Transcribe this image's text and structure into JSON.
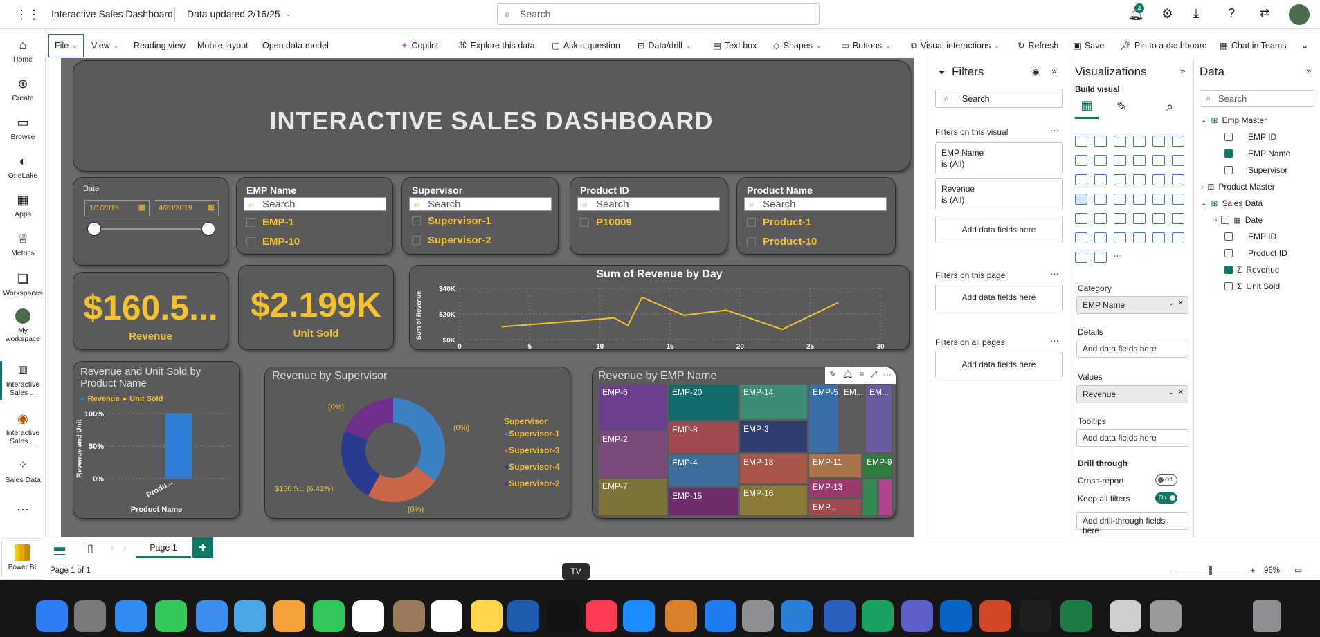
{
  "app": {
    "title": "Interactive Sales Dashboard",
    "updated": "Data updated 2/16/25",
    "search_placeholder": "Search",
    "notif_count": "4"
  },
  "menu": {
    "file": "File",
    "view": "View",
    "reading": "Reading view",
    "mobile": "Mobile layout",
    "open_model": "Open data model",
    "copilot": "Copilot",
    "explore": "Explore this data",
    "ask": "Ask a question",
    "datadrill": "Data/drill",
    "textbox": "Text box",
    "shapes": "Shapes",
    "buttons": "Buttons",
    "visual_interactions": "Visual interactions",
    "refresh": "Refresh",
    "save": "Save",
    "pin": "Pin to a dashboard",
    "chat": "Chat in Teams"
  },
  "nav": [
    {
      "label": "Home"
    },
    {
      "label": "Create"
    },
    {
      "label": "Browse"
    },
    {
      "label": "OneLake"
    },
    {
      "label": "Apps"
    },
    {
      "label": "Metrics"
    },
    {
      "label": "Workspaces"
    },
    {
      "label": "My workspace"
    },
    {
      "label": "Interactive Sales ..."
    },
    {
      "label": "Interactive Sales ..."
    },
    {
      "label": "Sales Data"
    }
  ],
  "dashboard": {
    "title": "INTERACTIVE SALES DASHBOARD",
    "date_slicer": {
      "label": "Date",
      "start": "1/1/2019",
      "end": "4/20/2019"
    },
    "slicers": [
      {
        "header": "EMP Name",
        "search": "Search",
        "items": [
          "EMP-1",
          "EMP-10"
        ]
      },
      {
        "header": "Supervisor",
        "search": "Search",
        "items": [
          "Supervisor-1",
          "Supervisor-2"
        ]
      },
      {
        "header": "Product ID",
        "search": "Search",
        "items": [
          "P10009"
        ]
      },
      {
        "header": "Product Name",
        "search": "Search",
        "items": [
          "Product-1",
          "Product-10"
        ]
      }
    ],
    "kpi_revenue": {
      "value": "$160.5...",
      "label": "Revenue"
    },
    "kpi_units": {
      "value": "$2.199K",
      "label": "Unit Sold"
    },
    "line_chart": {
      "title": "Sum of Revenue by Day",
      "ylabel": "Sum of Revenue"
    },
    "bar_chart": {
      "title": "Revenue and Unit Sold by Product Name",
      "ylabel": "Revenue and Unit",
      "xlabel": "Product Name",
      "legend": [
        "Revenue",
        "Unit Sold"
      ],
      "category": "Produ..."
    },
    "donut": {
      "title": "Revenue by Supervisor",
      "legend_title": "Supervisor",
      "legend": [
        "Supervisor-1",
        "Supervisor-3",
        "Supervisor-4",
        "Supervisor-2"
      ],
      "labels": [
        "(0%)",
        "(0%)",
        "(0%)",
        "$160.5... (6.41%)"
      ]
    },
    "treemap": {
      "title": "Revenue by EMP Name"
    }
  },
  "chart_data": [
    {
      "type": "line",
      "title": "Sum of Revenue by Day",
      "xlabel": "",
      "ylabel": "Sum of Revenue",
      "xlim": [
        0,
        30
      ],
      "ylim": [
        0,
        40000
      ],
      "x_ticks": [
        "0",
        "5",
        "10",
        "15",
        "20",
        "25",
        "30"
      ],
      "y_ticks": [
        "$0K",
        "$20K",
        "$40K"
      ],
      "grid": true,
      "series": [
        {
          "x": [
            3,
            10,
            11,
            12,
            13,
            16,
            19,
            23,
            27
          ],
          "values": [
            10000,
            16000,
            17000,
            11000,
            33000,
            19000,
            23000,
            8000,
            29000
          ]
        }
      ],
      "color": "#f2c230"
    },
    {
      "type": "bar",
      "title": "Revenue and Unit Sold by Product Name",
      "categories": [
        "Produ..."
      ],
      "y_ticks": [
        "0%",
        "50%",
        "100%"
      ],
      "series": [
        {
          "name": "Revenue",
          "values": [
            96
          ]
        },
        {
          "name": "Unit Sold",
          "values": [
            4
          ]
        }
      ],
      "colors": [
        "#2f7ed8",
        "#f2c230"
      ]
    },
    {
      "type": "pie",
      "title": "Revenue by Supervisor",
      "series": [
        {
          "name": "Supervisor-1",
          "value": 35,
          "color": "#3b82c4"
        },
        {
          "name": "Supervisor-3",
          "value": 23,
          "color": "#c8674a"
        },
        {
          "name": "Supervisor-4",
          "value": 23,
          "color": "#2a3b8f"
        },
        {
          "name": "Supervisor-2",
          "value": 19,
          "color": "#6e2f8a"
        }
      ]
    },
    {
      "type": "treemap",
      "title": "Revenue by EMP Name",
      "labels": [
        "EMP-6",
        "EMP-2",
        "EMP-7",
        "EMP-20",
        "EMP-8",
        "EMP-4",
        "EMP-15",
        "EMP-14",
        "EMP-3",
        "EMP-18",
        "EMP-16",
        "EMP-5",
        "EM...",
        "EM...",
        "EMP-11",
        "EMP-9",
        "EMP-13",
        "EMP..."
      ]
    }
  ],
  "filters": {
    "title": "Filters",
    "search": "Search",
    "on_visual": "Filters on this visual",
    "emp_name": "EMP Name",
    "is_all": "is (All)",
    "revenue": "Revenue",
    "is_all2": "is (All)",
    "add": "Add data fields here",
    "on_page": "Filters on this page",
    "add2": "Add data fields here",
    "on_all": "Filters on all pages",
    "add3": "Add data fields here"
  },
  "viz": {
    "title": "Visualizations",
    "build": "Build visual",
    "category": "Category",
    "category_field": "EMP Name",
    "details": "Details",
    "details_add": "Add data fields here",
    "values": "Values",
    "values_field": "Revenue",
    "tooltips": "Tooltips",
    "tooltips_add": "Add data fields here",
    "drill": "Drill through",
    "cross": "Cross-report",
    "cross_state": "Off",
    "keep": "Keep all filters",
    "keep_state": "On",
    "drill_add": "Add drill-through fields here"
  },
  "data": {
    "title": "Data",
    "search": "Search",
    "tables": [
      {
        "name": "Emp Master",
        "fields": [
          "EMP ID",
          "EMP Name",
          "Supervisor"
        ]
      },
      {
        "name": "Product Master"
      },
      {
        "name": "Sales Data",
        "fields": [
          "Date",
          "EMP ID",
          "Product ID",
          "Revenue",
          "Unit Sold"
        ]
      }
    ]
  },
  "status": {
    "page_tab": "Page 1",
    "page_info": "Page 1 of 1",
    "zoom": "96%",
    "powerbi": "Power BI",
    "tooltip": "TV"
  }
}
